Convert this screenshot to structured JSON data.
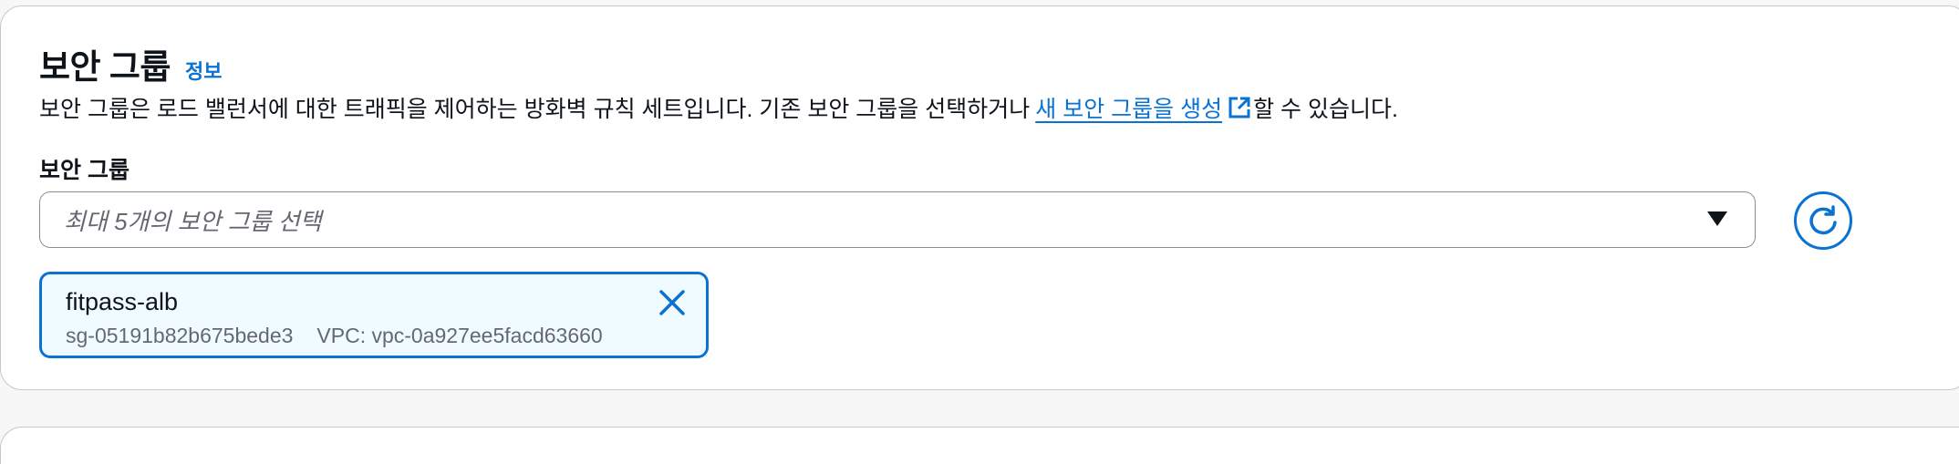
{
  "section": {
    "title": "보안 그룹",
    "info_link": "정보",
    "description_prefix": "보안 그룹은 로드 밸런서에 대한 트래픽을 제어하는 방화벽 규칙 세트입니다. 기존 보안 그룹을 선택하거나",
    "description_link": "새 보안 그룹을 생성",
    "description_suffix": "할 수 있습니다."
  },
  "field": {
    "label": "보안 그룹",
    "placeholder": "최대 5개의 보안 그룹 선택"
  },
  "selected_groups": [
    {
      "name": "fitpass-alb",
      "id": "sg-05191b82b675bede3",
      "vpc": "VPC: vpc-0a927ee5facd63660"
    }
  ],
  "icons": {
    "external_link": "external-link-icon",
    "dropdown": "caret-down-icon",
    "refresh": "refresh-icon",
    "remove": "close-icon"
  },
  "colors": {
    "accent": "#0972d3",
    "text": "#0f141a",
    "muted": "#656871",
    "token_bg": "#f0fbff"
  }
}
